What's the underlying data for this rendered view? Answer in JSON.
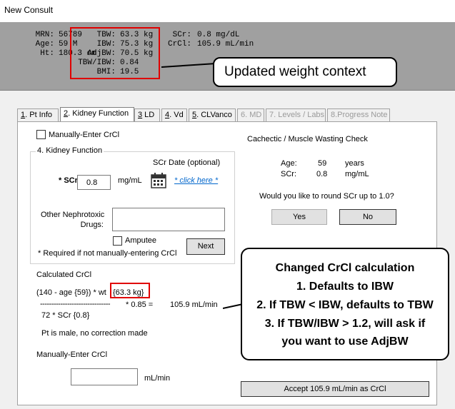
{
  "window": {
    "title": "New Consult"
  },
  "header": {
    "mrn_label": "MRN:",
    "mrn": "56789",
    "age_label": "Age:",
    "age": "59 M",
    "ht_label": "Ht:",
    "ht": "180.3 cm",
    "tbw_label": "TBW:",
    "tbw": "63.3 kg",
    "ibw_label": "IBW:",
    "ibw": "75.3 kg",
    "adjbw_label": "AdjBW:",
    "adjbw": "70.5 kg",
    "tbw_ibw_label": "TBW/IBW:",
    "tbw_ibw": "0.84",
    "bmi_label": "BMI:",
    "bmi": "19.5",
    "scr_label": "SCr:",
    "scr": "0.8 mg/dL",
    "crcl_label": "CrCl:",
    "crcl": "105.9 mL/min"
  },
  "callouts": {
    "weight": "Updated weight context",
    "crcl_lines": [
      "Changed CrCl calculation",
      "1. Defaults to IBW",
      "2. If TBW < IBW, defaults to TBW",
      "3. If TBW/IBW > 1.2, will ask if",
      "you want to use AdjBW"
    ]
  },
  "tabs": [
    {
      "num": "1",
      "label": ". Pt Info",
      "active": false,
      "disabled": false
    },
    {
      "num": "2",
      "label": ". Kidney Function",
      "active": true,
      "disabled": false
    },
    {
      "num": "3",
      "label": " LD",
      "active": false,
      "disabled": false
    },
    {
      "num": "4",
      "label": ". Vd",
      "active": false,
      "disabled": false
    },
    {
      "num": "5",
      "label": ". CLVanco",
      "active": false,
      "disabled": false
    },
    {
      "num": "",
      "label": "6. MD",
      "active": false,
      "disabled": true
    },
    {
      "num": "",
      "label": "7. Levels / Labs",
      "active": false,
      "disabled": true
    },
    {
      "num": "",
      "label": "8.Progress Note",
      "active": false,
      "disabled": true
    }
  ],
  "kidney": {
    "manual_checkbox_label": "Manually-Enter CrCl",
    "group_title": "4. Kidney Function",
    "scr_label": "* SCr",
    "scr_value": "0.8",
    "scr_unit": "mg/mL",
    "scr_date_label": "SCr Date (optional)",
    "click_here": "* click here *",
    "other_drugs_label_1": "Other Nephrotoxic",
    "other_drugs_label_2": "Drugs:",
    "other_drugs_value": "",
    "amputee_label": "Amputee",
    "required_note": "* Required if not manually-entering CrCl",
    "next_button": "Next"
  },
  "cachectic": {
    "title": "Cachectic / Muscle Wasting Check",
    "age_label": "Age:",
    "age_value": "59",
    "age_unit": "years",
    "scr_label": "SCr:",
    "scr_value": "0.8",
    "scr_unit": "mg/mL",
    "question": "Would you like to round SCr up to 1.0?",
    "yes": "Yes",
    "no": "No"
  },
  "calculated": {
    "title": "Calculated CrCl",
    "numerator_prefix": "(140 - age {59}) * wt",
    "weight": "{63.3 kg}",
    "dashes": "-------------------------------",
    "factor": "* 0.85 =",
    "result": "105.9 mL/min",
    "denominator": "72 * SCr {0.8}",
    "note": "Pt is male, no correction made"
  },
  "manual": {
    "title": "Manually-Enter CrCl",
    "value": "",
    "unit": "mL/min"
  },
  "accept_button": "Accept 105.9 mL/min as CrCl"
}
